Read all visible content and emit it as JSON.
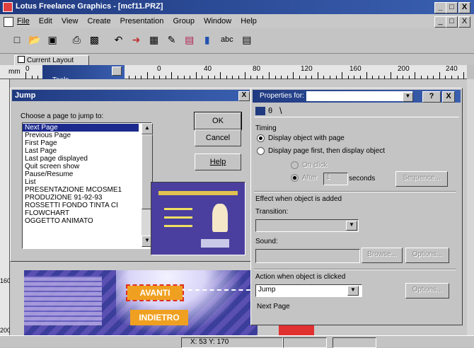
{
  "app": {
    "title": "Lotus Freelance Graphics - [mcf11.PRZ]",
    "win_buttons": [
      "_",
      "□",
      "X"
    ],
    "doc_buttons": [
      "_",
      "□",
      "X"
    ]
  },
  "menu": [
    "File",
    "Edit",
    "View",
    "Create",
    "Presentation",
    "Group",
    "Window",
    "Help"
  ],
  "toolbar": {
    "icons": [
      "new-icon",
      "open-icon",
      "save-icon",
      "print-icon",
      "screen-show-icon",
      "undo-icon",
      "pointer-icon",
      "symbol-icon",
      "drawing-icon",
      "add-page-icon",
      "chart-icon",
      "text-icon",
      "table-icon"
    ],
    "text_tool": "abc"
  },
  "layout_tab": "Current Layout",
  "ruler": {
    "unit": "mm",
    "labels": [
      "0",
      "0",
      "40",
      "80",
      "120",
      "160",
      "200",
      "240"
    ],
    "left_labels": [
      "160",
      "200"
    ]
  },
  "tools_palette": {
    "title": "Tools"
  },
  "jump_dialog": {
    "title": "Jump",
    "prompt": "Choose a page to jump to:",
    "pages": [
      "Next Page",
      "Previous Page",
      "First Page",
      "Last Page",
      "Last page displayed",
      "Quit screen show",
      "Pause/Resume",
      "List",
      "PRESENTAZIONE MCOSME1",
      "PRODUZIONE 91-92-93",
      "ROSSETTI FONDO TINTA CI",
      "FLOWCHART",
      "OGGETTO ANIMATO"
    ],
    "selected_index": 0,
    "ok": "OK",
    "cancel": "Cancel",
    "help": "Help",
    "close": "X"
  },
  "properties": {
    "title": "Properties for:",
    "help_button": "?",
    "close": "X",
    "timing_label": "Timing",
    "display_with_page": "Display object with page",
    "display_after": "Display page first, then display object",
    "on_click": "On click",
    "after": "After",
    "after_value": "1",
    "seconds": "seconds",
    "sequence": "Sequence...",
    "effect_label": "Effect when object is added",
    "transition_label": "Transition:",
    "sound_label": "Sound:",
    "browse": "Browse...",
    "options": "Options...",
    "action_label": "Action when object is clicked",
    "action_value": "Jump",
    "action_target": "Next Page",
    "action_options": "Options..."
  },
  "slide": {
    "buttons": [
      "AVANTI",
      "INDIETRO"
    ]
  },
  "status": {
    "coords": "X: 53    Y: 170"
  },
  "colors": {
    "title_bar": "#203a80",
    "selection": "#1c2a8e",
    "slide_bg": "#3b3e9a",
    "avanti_fill": "#f0a020"
  }
}
